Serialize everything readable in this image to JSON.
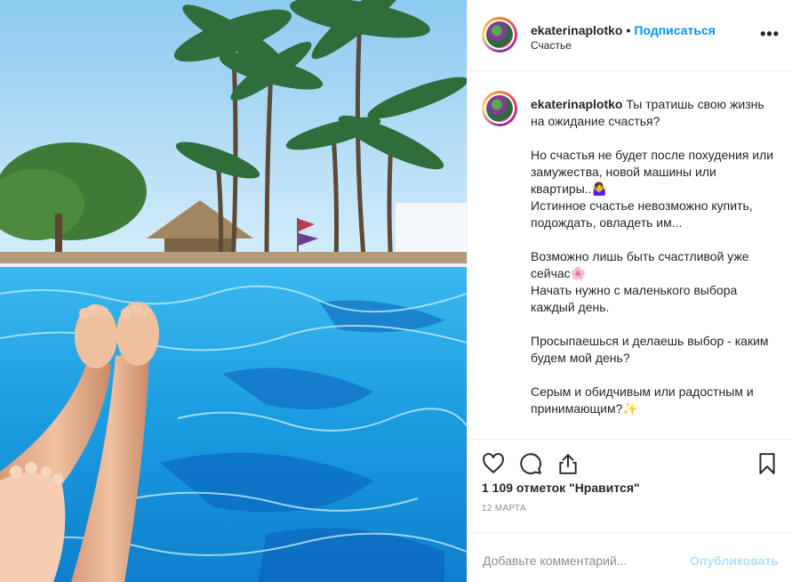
{
  "header": {
    "username": "ekaterinaplotko",
    "separator": "•",
    "follow_label": "Подписаться",
    "location": "Счастье",
    "more": "•••"
  },
  "caption": {
    "username": "ekaterinaplotko",
    "text": " Ты тратишь свою жизнь на ожидание счастья?\n\nНо счастья не будет после похудения или замужества, новой машины или квартиры..🤷‍♀️\nИстинное счастье невозможно купить, подождать, овладеть им...\n\nВозможно лишь быть счастливой уже сейчас🌸\nНачать нужно с маленького выбора каждый день.\n\nПросыпаешься и делаешь выбор - каким будем мой день?\n\nСерым и обидчивым или радостным и принимающим?✨"
  },
  "actions": {
    "icons": [
      "heart-icon",
      "comment-icon",
      "share-icon",
      "bookmark-icon"
    ],
    "likes": "1 109 отметок \"Нравится\"",
    "date": "12 марта"
  },
  "comment_box": {
    "placeholder": "Добавьте комментарий...",
    "publish": "Опубликовать"
  },
  "colors": {
    "accent": "#0095f6",
    "publish_disabled": "#b2dffc",
    "pool": "#1aa6e8",
    "sky": "#bfe3f7"
  }
}
